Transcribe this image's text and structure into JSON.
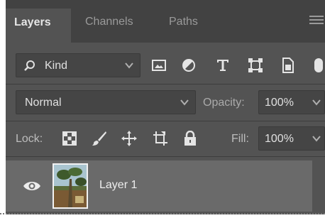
{
  "tabs": [
    {
      "label": "Layers",
      "active": true
    },
    {
      "label": "Channels",
      "active": false
    },
    {
      "label": "Paths",
      "active": false
    }
  ],
  "filter": {
    "kind_label": "Kind",
    "icons": [
      "image-filter-icon",
      "adjustment-filter-icon",
      "type-filter-icon",
      "shape-filter-icon",
      "smart-object-filter-icon",
      "filter-toggle-icon"
    ]
  },
  "blend": {
    "mode": "Normal",
    "opacity_label": "Opacity:",
    "opacity_value": "100%"
  },
  "lock": {
    "label": "Lock:",
    "icons": [
      "lock-transparent-pixels-icon",
      "lock-image-pixels-icon",
      "lock-position-icon",
      "lock-artboard-icon",
      "lock-all-icon"
    ],
    "fill_label": "Fill:",
    "fill_value": "100%"
  },
  "layers": [
    {
      "name": "Layer 1",
      "visible": true
    }
  ],
  "colors": {
    "panel_bg": "#535353",
    "tabbar_bg": "#424242",
    "selected_layer_bg": "#6a6a6a"
  }
}
